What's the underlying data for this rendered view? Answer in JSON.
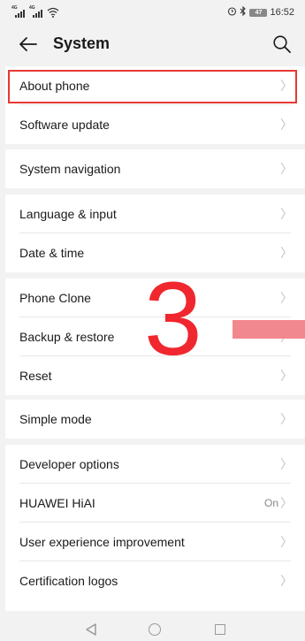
{
  "status_bar": {
    "network_1": "4G",
    "network_2": "4G",
    "battery": "47",
    "time": "16:52"
  },
  "header": {
    "title": "System"
  },
  "groups": [
    {
      "items": [
        {
          "label": "About phone"
        },
        {
          "label": "Software update"
        }
      ]
    },
    {
      "items": [
        {
          "label": "System navigation"
        }
      ]
    },
    {
      "items": [
        {
          "label": "Language & input"
        },
        {
          "label": "Date & time"
        }
      ]
    },
    {
      "items": [
        {
          "label": "Phone Clone"
        },
        {
          "label": "Backup & restore"
        },
        {
          "label": "Reset"
        }
      ]
    },
    {
      "items": [
        {
          "label": "Simple mode"
        }
      ]
    },
    {
      "items": [
        {
          "label": "Developer options"
        },
        {
          "label": "HUAWEI HiAI",
          "value": "On"
        },
        {
          "label": "User experience improvement"
        },
        {
          "label": "Certification logos"
        }
      ]
    }
  ],
  "overlay": {
    "number": "3"
  },
  "colors": {
    "highlight": "#e53935",
    "overlay_number": "#f0272e",
    "pink_bar": "#f2888f"
  },
  "icons": {
    "back": "back-arrow-icon",
    "search": "search-icon",
    "chevron": "chevron-right-icon",
    "nav_back": "triangle-back-icon",
    "nav_home": "circle-home-icon",
    "nav_recent": "square-recent-icon"
  }
}
